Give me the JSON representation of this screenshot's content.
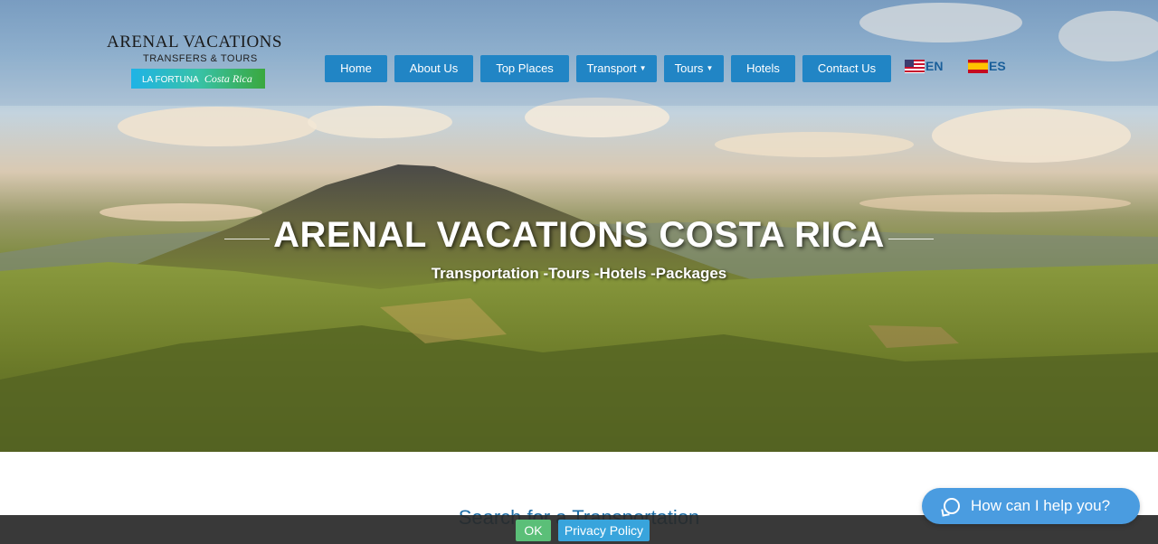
{
  "logo": {
    "main": "ARENAL VACATIONS",
    "sub": "TRANSFERS & TOURS",
    "badge_prefix": "LA FORTUNA",
    "badge_script": "Costa Rica"
  },
  "nav": {
    "items": [
      {
        "label": "Home"
      },
      {
        "label": "About Us"
      },
      {
        "label": "Top Places"
      },
      {
        "label": "Transport"
      },
      {
        "label": "Tours"
      },
      {
        "label": "Hotels"
      },
      {
        "label": "Contact Us"
      }
    ],
    "lang_en": "EN",
    "lang_es": "ES"
  },
  "hero": {
    "title": "ARENAL VACATIONS COSTA RICA",
    "subtitle": "Transportation -Tours -Hotels -Packages"
  },
  "search": {
    "title": "Search for a Transportation"
  },
  "cookie": {
    "ok_label": "OK",
    "privacy_label": "Privacy Policy"
  },
  "chat": {
    "label": "How can I help you?"
  },
  "colors": {
    "nav_button": "#2185c5",
    "chat_button": "#4a9ce0",
    "ok_button": "#5bbf78",
    "privacy_button": "#38a4dc"
  }
}
